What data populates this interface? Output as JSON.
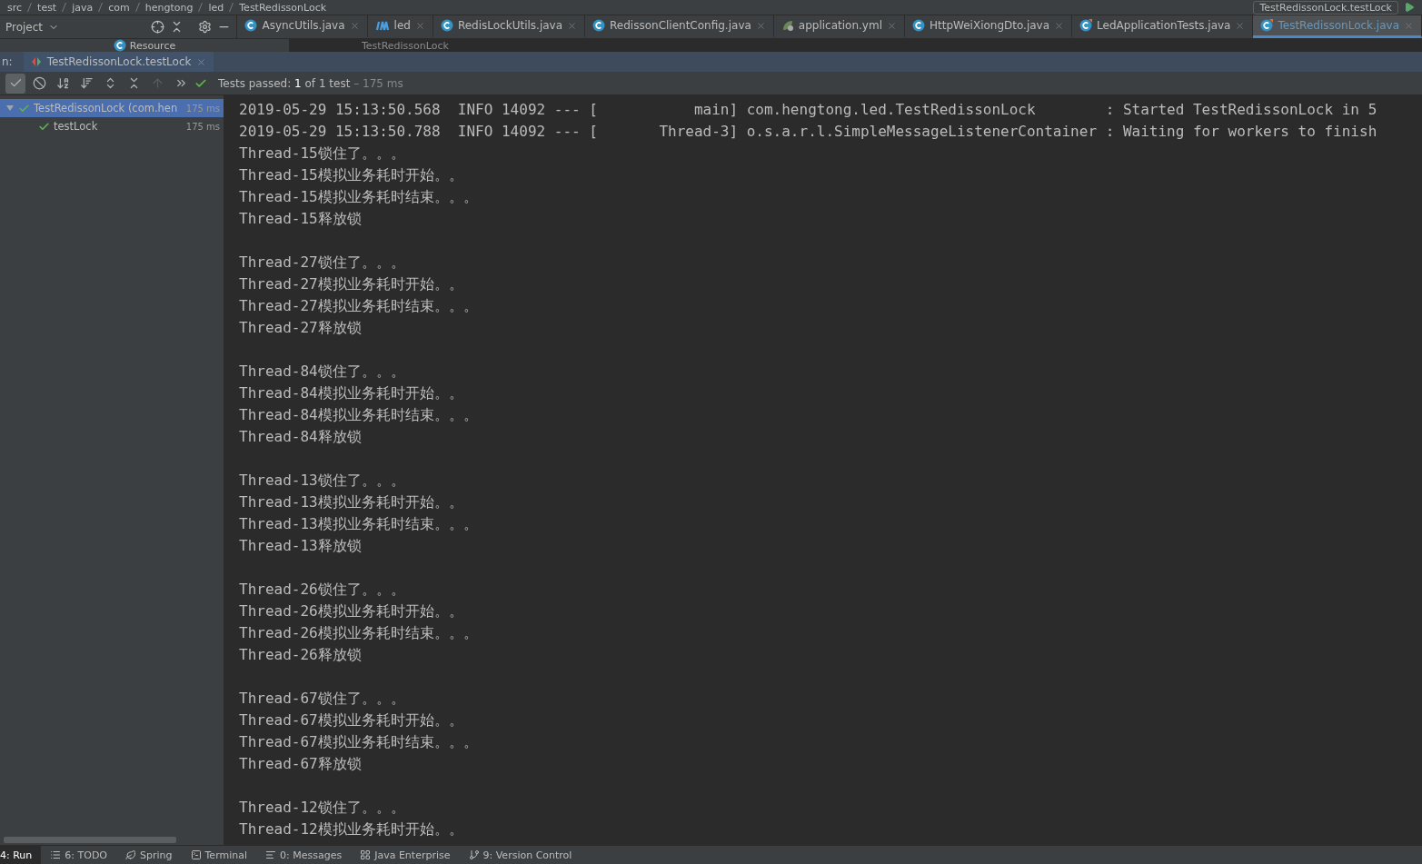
{
  "breadcrumb": [
    "src",
    "test",
    "java",
    "com",
    "hengtong",
    "led",
    "TestRedissonLock"
  ],
  "run_config": "TestRedissonLock.testLock",
  "project_panel": {
    "title": "Project",
    "item": "Resource"
  },
  "editor_tabs": [
    {
      "label": "AsyncUtils.java",
      "kind": "class",
      "selected": false
    },
    {
      "label": "led",
      "kind": "module",
      "selected": false
    },
    {
      "label": "RedisLockUtils.java",
      "kind": "class",
      "selected": false
    },
    {
      "label": "RedissonClientConfig.java",
      "kind": "class",
      "selected": false
    },
    {
      "label": "application.yml",
      "kind": "yml",
      "selected": false
    },
    {
      "label": "HttpWeiXiongDto.java",
      "kind": "class",
      "selected": false
    },
    {
      "label": "LedApplicationTests.java",
      "kind": "test",
      "selected": false
    },
    {
      "label": "TestRedissonLock.java",
      "kind": "test",
      "selected": true
    }
  ],
  "editor_hint": "TestRedissonLock",
  "run_panel": {
    "prefix": "n:",
    "tab": "TestRedissonLock.testLock",
    "toolbar": [
      {
        "kind": "passed",
        "selected": true
      },
      {
        "kind": "ignored",
        "selected": false
      },
      {
        "kind": "sort-alpha",
        "selected": false
      },
      {
        "kind": "sort-duration",
        "selected": false
      },
      {
        "kind": "expand",
        "selected": false
      },
      {
        "kind": "collapse",
        "selected": false
      },
      {
        "kind": "previous",
        "selected": false,
        "disabled": true
      },
      {
        "kind": "more",
        "selected": false
      }
    ],
    "status": {
      "label": "Tests passed:",
      "count": "1",
      "rest": "of 1 test",
      "separator": "–",
      "time": "175 ms"
    }
  },
  "test_tree": [
    {
      "name": "TestRedissonLock (com.hen",
      "time": "175 ms",
      "passed": true,
      "selected": true,
      "expanded": true,
      "children": [
        {
          "name": "testLock",
          "time": "175 ms",
          "passed": true,
          "selected": false
        }
      ]
    }
  ],
  "console": {
    "log_lines": [
      "2019-05-29 15:13:50.568  INFO 14092 --- [           main] com.hengtong.led.TestRedissonLock        : Started TestRedissonLock in 5",
      "2019-05-29 15:13:50.788  INFO 14092 --- [       Thread-3] o.s.a.r.l.SimpleMessageListenerContainer : Waiting for workers to finish"
    ],
    "blocks": [
      [
        "Thread-15锁住了。。。",
        "Thread-15模拟业务耗时开始。。",
        "Thread-15模拟业务耗时结束。。。",
        "Thread-15释放锁"
      ],
      [
        "Thread-27锁住了。。。",
        "Thread-27模拟业务耗时开始。。",
        "Thread-27模拟业务耗时结束。。。",
        "Thread-27释放锁"
      ],
      [
        "Thread-84锁住了。。。",
        "Thread-84模拟业务耗时开始。。",
        "Thread-84模拟业务耗时结束。。。",
        "Thread-84释放锁"
      ],
      [
        "Thread-13锁住了。。。",
        "Thread-13模拟业务耗时开始。。",
        "Thread-13模拟业务耗时结束。。。",
        "Thread-13释放锁"
      ],
      [
        "Thread-26锁住了。。。",
        "Thread-26模拟业务耗时开始。。",
        "Thread-26模拟业务耗时结束。。。",
        "Thread-26释放锁"
      ],
      [
        "Thread-67锁住了。。。",
        "Thread-67模拟业务耗时开始。。",
        "Thread-67模拟业务耗时结束。。。",
        "Thread-67释放锁"
      ],
      [
        "Thread-12锁住了。。。",
        "Thread-12模拟业务耗时开始。。"
      ]
    ]
  },
  "tool_windows": [
    {
      "label": "4: Run",
      "kind": "run",
      "selected": true
    },
    {
      "label": "6: TODO",
      "kind": "todo",
      "selected": false
    },
    {
      "label": "Spring",
      "kind": "spring",
      "selected": false
    },
    {
      "label": "Terminal",
      "kind": "terminal",
      "selected": false
    },
    {
      "label": "0: Messages",
      "kind": "messages",
      "selected": false
    },
    {
      "label": "Java Enterprise",
      "kind": "enterprise",
      "selected": false
    },
    {
      "label": "9: Version Control",
      "kind": "vcs",
      "selected": false
    }
  ]
}
